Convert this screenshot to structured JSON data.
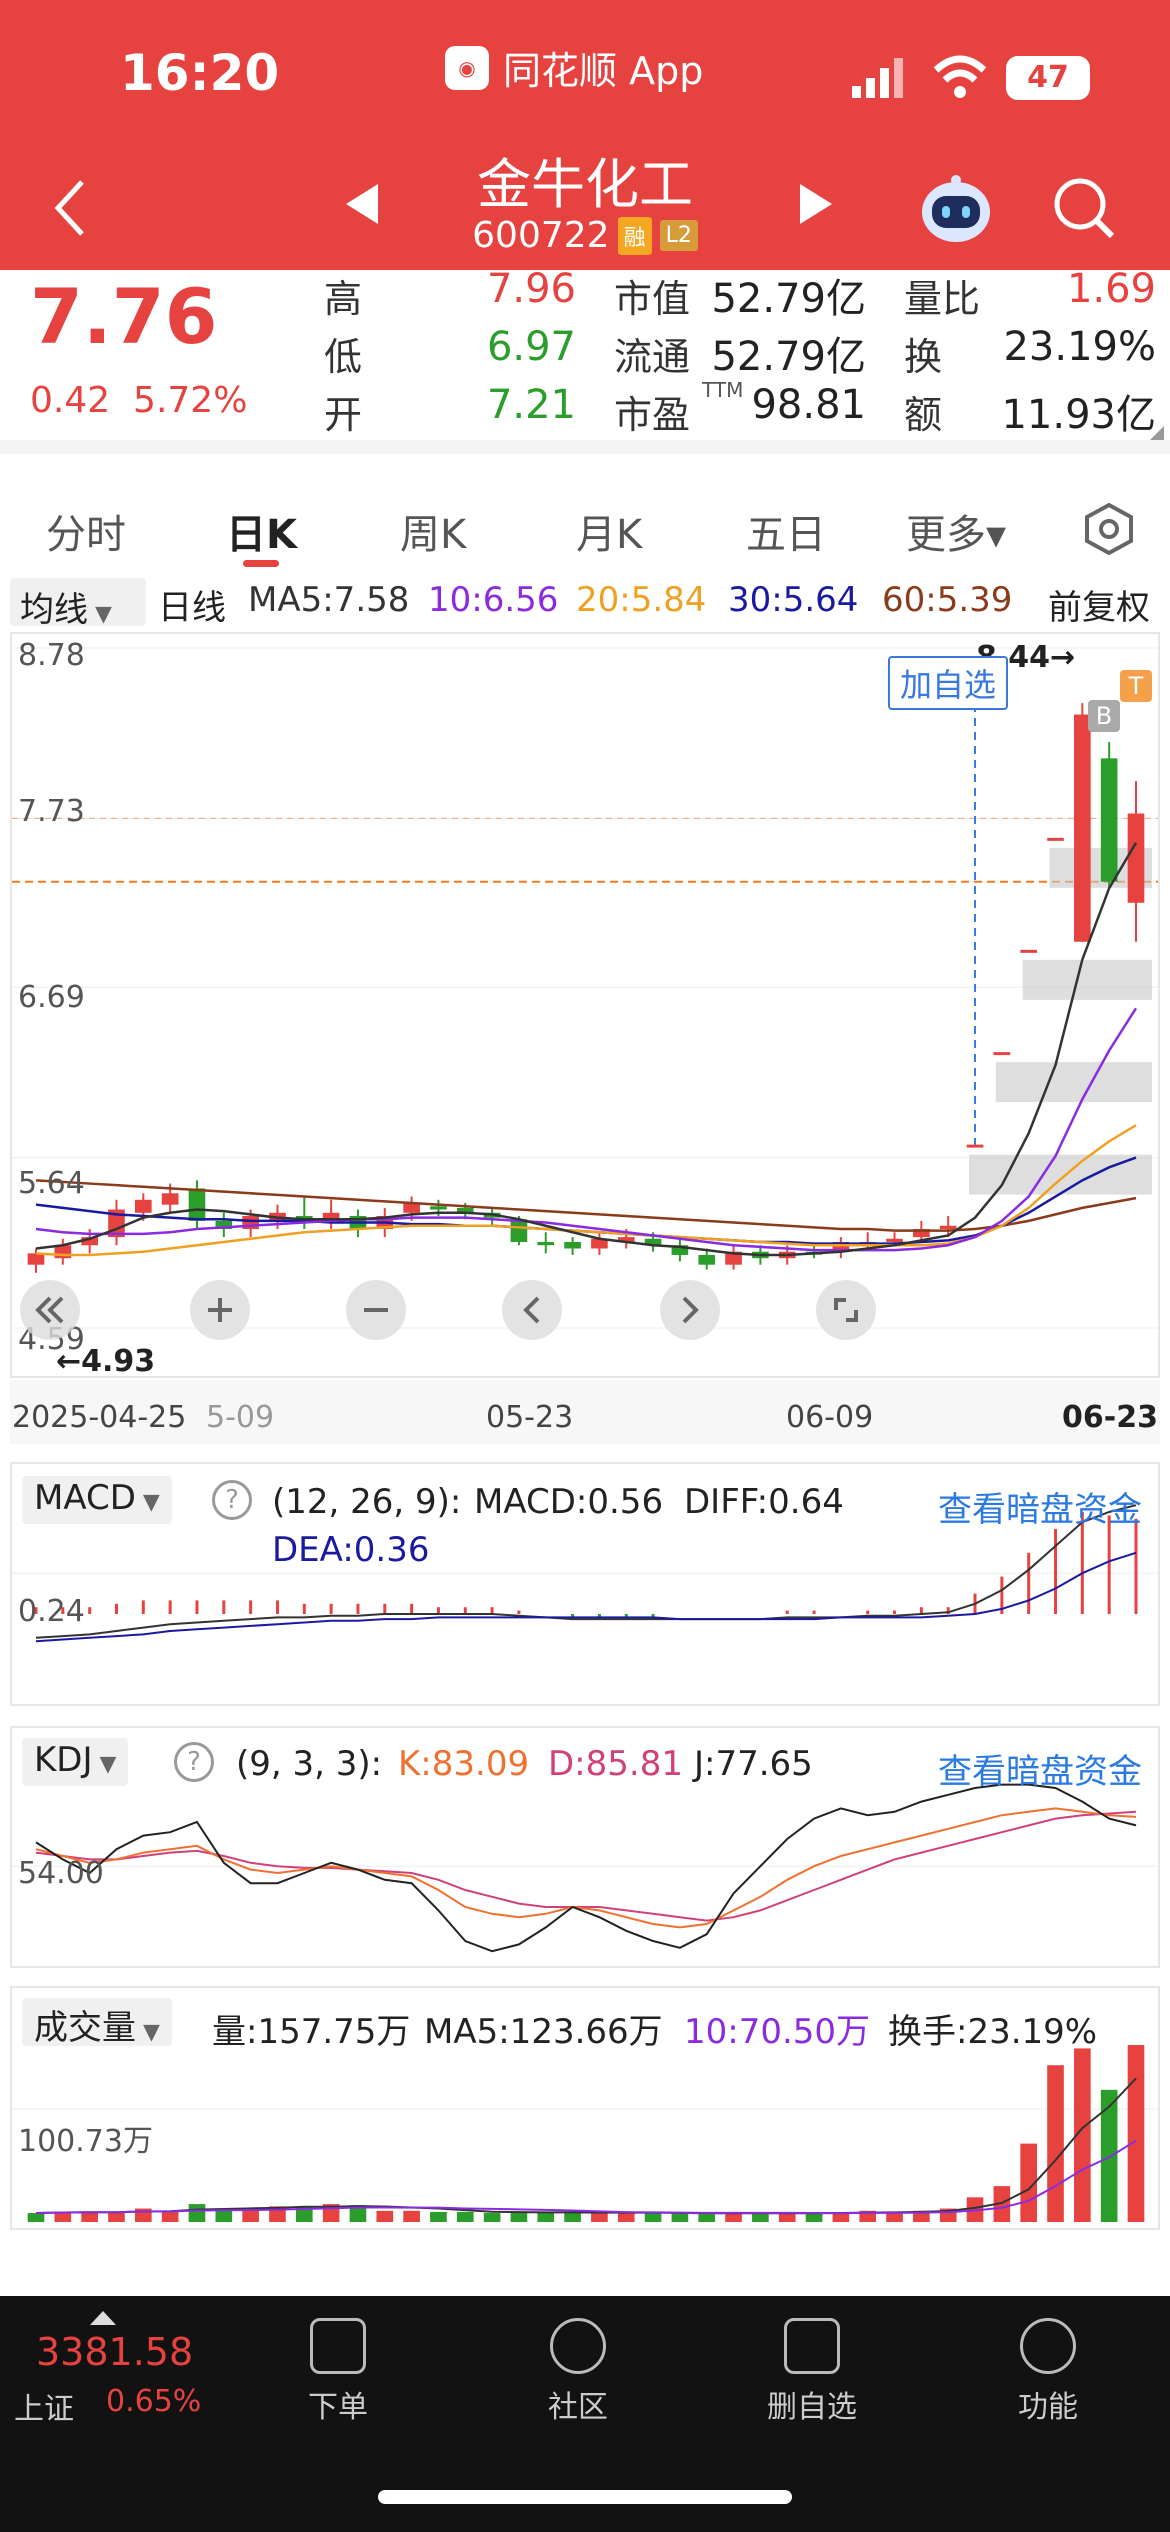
{
  "status_bar": {
    "time": "16:20",
    "app": "同花顺 App",
    "battery": "47"
  },
  "header": {
    "stock_name": "金牛化工",
    "stock_code": "600722",
    "tag1": "融",
    "tag2": "L2"
  },
  "quote": {
    "price": "7.76",
    "change": "0.42",
    "change_pct": "5.72%",
    "high_label": "高",
    "high": "7.96",
    "low_label": "低",
    "low": "6.97",
    "open_label": "开",
    "open": "7.21",
    "mcap_label": "市值",
    "mcap": "52.79亿",
    "float_label": "流通",
    "float": "52.79亿",
    "pe_label": "市盈",
    "pe_sup": "TTM",
    "pe": "98.81",
    "vr_label": "量比",
    "vr": "1.69",
    "turn_label": "换",
    "turn": "23.19%",
    "amt_label": "额",
    "amt": "11.93亿"
  },
  "tabs": [
    "分时",
    "日K",
    "周K",
    "月K",
    "五日",
    "更多▾"
  ],
  "ma": {
    "selector": "均线",
    "period": "日线",
    "ma5": "MA5:7.58",
    "ma10": "10:6.56",
    "ma20": "20:5.84",
    "ma30": "30:5.64",
    "ma60": "60:5.39",
    "adj": "前复权"
  },
  "colors": {
    "ma5": "#333333",
    "ma10": "#8a2be2",
    "ma20": "#f0a020",
    "ma30": "#1a1aa0",
    "ma60": "#8b3a1a",
    "up": "#e64340",
    "down": "#2a9d2a"
  },
  "kline": {
    "y_ticks": [
      "8.78",
      "7.73",
      "6.69",
      "5.64",
      "4.59"
    ],
    "x_ticks": [
      "2025-04-25",
      "5-09",
      "05-23",
      "06-09",
      "06-23"
    ],
    "max_label": "8.44→",
    "min_label": "←4.93",
    "add_watch": "加自选",
    "b_mark": "B",
    "t_mark": "T",
    "candles": [
      [
        4.98,
        5.05,
        4.93,
        5.08
      ],
      [
        5.02,
        5.1,
        4.98,
        5.14
      ],
      [
        5.1,
        5.15,
        5.05,
        5.2
      ],
      [
        5.15,
        5.32,
        5.1,
        5.38
      ],
      [
        5.3,
        5.38,
        5.25,
        5.42
      ],
      [
        5.35,
        5.42,
        5.3,
        5.48
      ],
      [
        5.45,
        5.25,
        5.2,
        5.5
      ],
      [
        5.25,
        5.2,
        5.15,
        5.3
      ],
      [
        5.2,
        5.28,
        5.15,
        5.32
      ],
      [
        5.25,
        5.3,
        5.2,
        5.35
      ],
      [
        5.28,
        5.25,
        5.2,
        5.4
      ],
      [
        5.25,
        5.3,
        5.2,
        5.38
      ],
      [
        5.28,
        5.2,
        5.15,
        5.32
      ],
      [
        5.2,
        5.28,
        5.15,
        5.33
      ],
      [
        5.3,
        5.36,
        5.25,
        5.4
      ],
      [
        5.34,
        5.32,
        5.28,
        5.38
      ],
      [
        5.33,
        5.3,
        5.26,
        5.36
      ],
      [
        5.3,
        5.27,
        5.22,
        5.33
      ],
      [
        5.26,
        5.12,
        5.1,
        5.28
      ],
      [
        5.12,
        5.1,
        5.05,
        5.18
      ],
      [
        5.12,
        5.08,
        5.04,
        5.15
      ],
      [
        5.08,
        5.14,
        5.04,
        5.18
      ],
      [
        5.12,
        5.15,
        5.08,
        5.2
      ],
      [
        5.14,
        5.1,
        5.06,
        5.18
      ],
      [
        5.1,
        5.04,
        5.0,
        5.14
      ],
      [
        5.04,
        4.98,
        4.95,
        5.08
      ],
      [
        4.98,
        5.06,
        4.95,
        5.1
      ],
      [
        5.06,
        5.02,
        4.98,
        5.1
      ],
      [
        5.02,
        5.06,
        4.98,
        5.1
      ],
      [
        5.06,
        5.05,
        5.02,
        5.1
      ],
      [
        5.06,
        5.12,
        5.02,
        5.15
      ],
      [
        5.12,
        5.12,
        5.08,
        5.18
      ],
      [
        5.12,
        5.14,
        5.1,
        5.18
      ],
      [
        5.15,
        5.2,
        5.12,
        5.25
      ],
      [
        5.2,
        5.22,
        5.15,
        5.28
      ],
      [
        5.72,
        5.72,
        5.72,
        5.72
      ],
      [
        6.29,
        6.29,
        6.29,
        6.29
      ],
      [
        6.92,
        6.92,
        6.92,
        6.92
      ],
      [
        7.61,
        7.61,
        7.61,
        7.61
      ],
      [
        6.97,
        8.37,
        6.97,
        8.44
      ],
      [
        8.1,
        7.34,
        7.3,
        8.2
      ],
      [
        7.21,
        7.76,
        6.97,
        7.96
      ]
    ],
    "ma5": [
      5.08,
      5.1,
      5.14,
      5.2,
      5.27,
      5.3,
      5.32,
      5.31,
      5.29,
      5.27,
      5.26,
      5.26,
      5.26,
      5.27,
      5.29,
      5.3,
      5.3,
      5.29,
      5.26,
      5.22,
      5.18,
      5.14,
      5.12,
      5.1,
      5.09,
      5.07,
      5.05,
      5.04,
      5.04,
      5.05,
      5.06,
      5.08,
      5.1,
      5.13,
      5.16,
      5.27,
      5.47,
      5.79,
      6.21,
      6.86,
      7.3,
      7.58
    ],
    "ma10": [
      5.2,
      5.18,
      5.17,
      5.17,
      5.17,
      5.18,
      5.2,
      5.21,
      5.22,
      5.23,
      5.24,
      5.25,
      5.26,
      5.26,
      5.27,
      5.27,
      5.27,
      5.26,
      5.25,
      5.24,
      5.22,
      5.2,
      5.18,
      5.16,
      5.14,
      5.12,
      5.1,
      5.09,
      5.08,
      5.07,
      5.07,
      5.07,
      5.07,
      5.08,
      5.1,
      5.15,
      5.25,
      5.4,
      5.65,
      6.0,
      6.3,
      6.56
    ],
    "ma20": [
      5.05,
      5.04,
      5.04,
      5.05,
      5.06,
      5.08,
      5.1,
      5.12,
      5.14,
      5.16,
      5.18,
      5.19,
      5.2,
      5.21,
      5.22,
      5.22,
      5.22,
      5.22,
      5.21,
      5.2,
      5.19,
      5.18,
      5.17,
      5.16,
      5.15,
      5.14,
      5.13,
      5.12,
      5.11,
      5.1,
      5.1,
      5.1,
      5.1,
      5.1,
      5.11,
      5.15,
      5.22,
      5.33,
      5.48,
      5.62,
      5.74,
      5.84
    ],
    "ma30": [
      5.35,
      5.33,
      5.31,
      5.29,
      5.28,
      5.27,
      5.26,
      5.26,
      5.25,
      5.25,
      5.25,
      5.24,
      5.24,
      5.24,
      5.23,
      5.23,
      5.22,
      5.22,
      5.21,
      5.2,
      5.19,
      5.18,
      5.17,
      5.16,
      5.15,
      5.14,
      5.13,
      5.12,
      5.12,
      5.11,
      5.11,
      5.11,
      5.11,
      5.12,
      5.13,
      5.16,
      5.22,
      5.3,
      5.4,
      5.5,
      5.58,
      5.64
    ],
    "ma60": [
      5.5,
      5.49,
      5.48,
      5.47,
      5.46,
      5.45,
      5.44,
      5.43,
      5.42,
      5.41,
      5.4,
      5.39,
      5.38,
      5.37,
      5.36,
      5.35,
      5.34,
      5.33,
      5.32,
      5.31,
      5.3,
      5.29,
      5.28,
      5.27,
      5.26,
      5.25,
      5.24,
      5.23,
      5.22,
      5.21,
      5.2,
      5.2,
      5.19,
      5.19,
      5.19,
      5.2,
      5.22,
      5.25,
      5.29,
      5.33,
      5.36,
      5.39
    ]
  },
  "macd": {
    "selector": "MACD",
    "params": "(12, 26, 9):",
    "macd": "MACD:0.56",
    "diff": "DIFF:0.64",
    "dea": "DEA:0.36",
    "y_tick": "0.24",
    "link": "查看暗盘资金",
    "diff_series": [
      -0.14,
      -0.13,
      -0.12,
      -0.1,
      -0.08,
      -0.06,
      -0.05,
      -0.04,
      -0.03,
      -0.02,
      -0.02,
      -0.01,
      -0.01,
      0.0,
      0.0,
      0.0,
      0.0,
      0.0,
      -0.01,
      -0.02,
      -0.03,
      -0.03,
      -0.03,
      -0.03,
      -0.03,
      -0.03,
      -0.03,
      -0.03,
      -0.02,
      -0.02,
      -0.02,
      -0.01,
      -0.01,
      0.0,
      0.01,
      0.06,
      0.14,
      0.26,
      0.4,
      0.54,
      0.6,
      0.64
    ],
    "dea_series": [
      -0.16,
      -0.15,
      -0.14,
      -0.13,
      -0.12,
      -0.1,
      -0.09,
      -0.08,
      -0.07,
      -0.06,
      -0.05,
      -0.04,
      -0.04,
      -0.03,
      -0.03,
      -0.02,
      -0.02,
      -0.02,
      -0.02,
      -0.02,
      -0.02,
      -0.02,
      -0.02,
      -0.02,
      -0.03,
      -0.03,
      -0.03,
      -0.03,
      -0.03,
      -0.03,
      -0.02,
      -0.02,
      -0.02,
      -0.02,
      -0.01,
      0.0,
      0.03,
      0.08,
      0.15,
      0.24,
      0.31,
      0.36
    ],
    "hist": [
      0.04,
      0.04,
      0.04,
      0.06,
      0.08,
      0.08,
      0.08,
      0.08,
      0.08,
      0.08,
      0.06,
      0.06,
      0.06,
      0.06,
      0.06,
      0.04,
      0.04,
      0.04,
      0.02,
      0.0,
      -0.02,
      -0.02,
      -0.02,
      -0.02,
      0.0,
      0.0,
      0.0,
      0.0,
      0.02,
      0.02,
      0.0,
      0.02,
      0.02,
      0.04,
      0.04,
      0.12,
      0.22,
      0.36,
      0.5,
      0.6,
      0.58,
      0.56
    ]
  },
  "kdj": {
    "selector": "KDJ",
    "params": "(9, 3, 3):",
    "k": "K:83.09",
    "d": "D:85.81",
    "j": "J:77.65",
    "y_tick": "54.00",
    "link": "查看暗盘资金",
    "k_series": [
      64,
      60,
      56,
      58,
      62,
      64,
      66,
      58,
      52,
      50,
      52,
      54,
      52,
      50,
      48,
      40,
      30,
      26,
      24,
      26,
      30,
      28,
      24,
      20,
      18,
      20,
      28,
      36,
      46,
      54,
      60,
      64,
      68,
      72,
      76,
      80,
      84,
      86,
      88,
      86,
      84,
      83
    ],
    "d_series": [
      62,
      60,
      58,
      58,
      60,
      62,
      63,
      60,
      56,
      54,
      53,
      53,
      52,
      51,
      50,
      46,
      40,
      36,
      32,
      30,
      30,
      30,
      28,
      26,
      24,
      22,
      24,
      28,
      34,
      40,
      46,
      52,
      58,
      62,
      66,
      70,
      74,
      78,
      82,
      84,
      85,
      86
    ],
    "j_series": [
      68,
      58,
      50,
      64,
      72,
      74,
      80,
      56,
      44,
      44,
      50,
      56,
      52,
      46,
      44,
      28,
      10,
      4,
      8,
      18,
      30,
      24,
      16,
      10,
      6,
      14,
      38,
      54,
      70,
      82,
      88,
      84,
      86,
      92,
      96,
      100,
      102,
      102,
      100,
      92,
      82,
      78
    ]
  },
  "volume": {
    "selector": "成交量",
    "vol": "量:157.75万",
    "ma5": "MA5:123.66万",
    "ma10": "10:70.50万",
    "turnover": "换手:23.19%",
    "y_tick": "100.73万",
    "bars": [
      8,
      9,
      9,
      9,
      12,
      9,
      16,
      12,
      12,
      14,
      14,
      16,
      15,
      10,
      10,
      9,
      9,
      8,
      8,
      9,
      9,
      8,
      8,
      8,
      8,
      7,
      8,
      8,
      8,
      8,
      8,
      10,
      9,
      10,
      12,
      22,
      32,
      70,
      140,
      155,
      118,
      158
    ],
    "up": [
      0,
      1,
      1,
      1,
      1,
      1,
      0,
      0,
      1,
      1,
      0,
      1,
      0,
      1,
      1,
      0,
      0,
      0,
      0,
      0,
      0,
      1,
      1,
      0,
      0,
      0,
      1,
      0,
      1,
      0,
      1,
      1,
      1,
      1,
      1,
      1,
      1,
      1,
      1,
      1,
      0,
      1
    ]
  },
  "footer": {
    "index_value": "3381.58",
    "index_name": "上证",
    "index_pct": "0.65%",
    "order": "下单",
    "community": "社区",
    "remove_watch": "删自选",
    "function": "功能"
  }
}
